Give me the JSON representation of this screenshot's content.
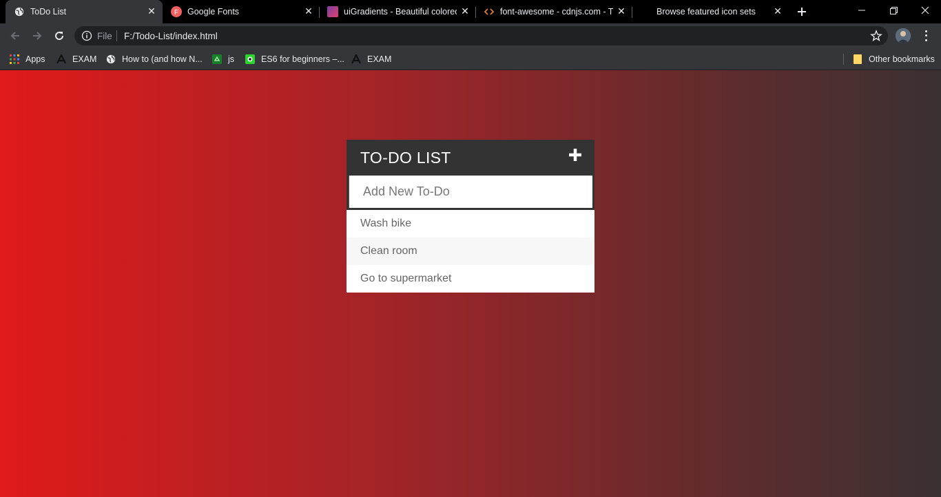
{
  "browser": {
    "tabs": [
      {
        "title": "ToDo List",
        "active": true,
        "icon": "globe-icon"
      },
      {
        "title": "Google Fonts",
        "active": false,
        "icon": "google-fonts-icon"
      },
      {
        "title": "uiGradients - Beautiful colored",
        "active": false,
        "icon": "uigradients-icon"
      },
      {
        "title": "font-awesome - cdnjs.com - Th",
        "active": false,
        "icon": "code-icon"
      },
      {
        "title": "Browse featured icon sets",
        "active": false,
        "icon": "blank-icon"
      }
    ],
    "close_glyph": "✕",
    "omnibox": {
      "scheme_label": "File",
      "url": "F:/Todo-List/index.html"
    },
    "bookmarks": [
      {
        "label": "Apps",
        "icon": "apps-grid-icon"
      },
      {
        "label": "EXAM",
        "icon": "font-a-icon"
      },
      {
        "label": "How to (and how N...",
        "icon": "globe-icon"
      },
      {
        "label": "js",
        "icon": "js-icon"
      },
      {
        "label": "ES6 for beginners –...",
        "icon": "es6-icon"
      },
      {
        "label": "EXAM",
        "icon": "font-a-icon"
      }
    ],
    "other_bookmarks": "Other bookmarks"
  },
  "todo": {
    "title": "TO-DO LIST",
    "input_placeholder": "Add New To-Do",
    "items": [
      "Wash bike",
      "Clean room",
      "Go to supermarket"
    ]
  },
  "colors": {
    "gradient_start": "#e01a1a",
    "gradient_end": "#3a3132",
    "header_bg": "#333333"
  }
}
